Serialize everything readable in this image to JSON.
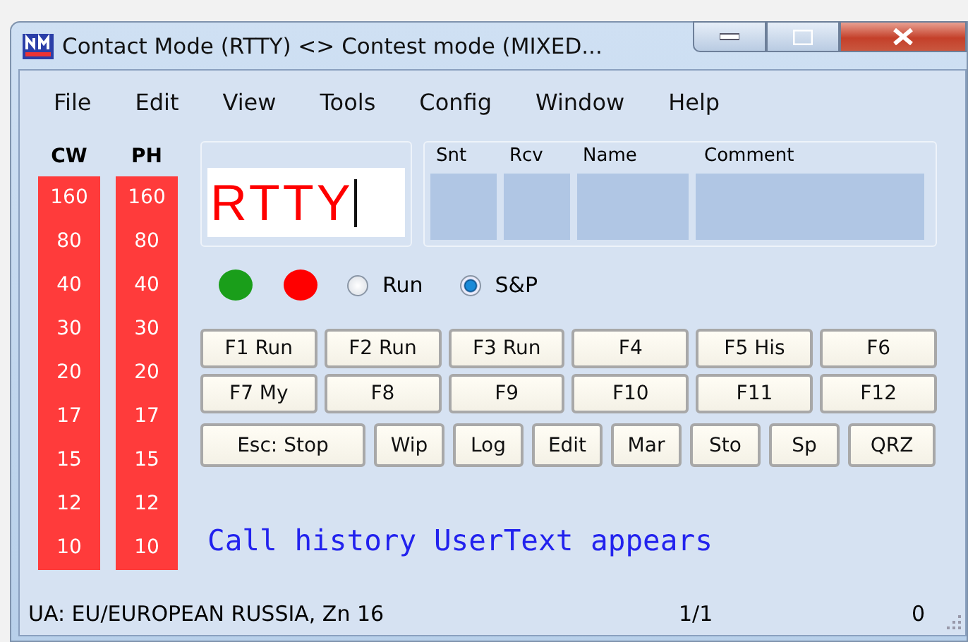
{
  "window": {
    "title": "Contact Mode (RTTY) <> Contest mode (MIXED..."
  },
  "menu": [
    "File",
    "Edit",
    "View",
    "Tools",
    "Config",
    "Window",
    "Help"
  ],
  "bands": [
    {
      "header": "CW",
      "items": [
        "160",
        "80",
        "40",
        "30",
        "20",
        "17",
        "15",
        "12",
        "10"
      ]
    },
    {
      "header": "PH",
      "items": [
        "160",
        "80",
        "40",
        "30",
        "20",
        "17",
        "15",
        "12",
        "10"
      ]
    }
  ],
  "call_field": {
    "value": "RTTY"
  },
  "exchange": [
    {
      "label": "Snt"
    },
    {
      "label": "Rcv"
    },
    {
      "label": "Name"
    },
    {
      "label": "Comment"
    }
  ],
  "indicators": [
    {
      "color": "#1a9e1a"
    },
    {
      "color": "#ff0000"
    }
  ],
  "mode_radios": [
    {
      "label": "Run",
      "selected": false
    },
    {
      "label": "S&P",
      "selected": true
    }
  ],
  "function_keys": [
    [
      "F1 Run",
      "F2 Run",
      "F3 Run",
      "F4",
      "F5 His",
      "F6"
    ],
    [
      "F7 My",
      "F8",
      "F9",
      "F10",
      "F11",
      "F12"
    ]
  ],
  "action_buttons": [
    "Esc: Stop",
    "Wip",
    "Log",
    "Edit",
    "Mar",
    "Sto",
    "Sp",
    "QRZ"
  ],
  "user_text": "Call history UserText appears",
  "status_bar": {
    "location": "UA: EU/EUROPEAN RUSSIA, Zn 16",
    "count": "1/1",
    "number": "0"
  }
}
